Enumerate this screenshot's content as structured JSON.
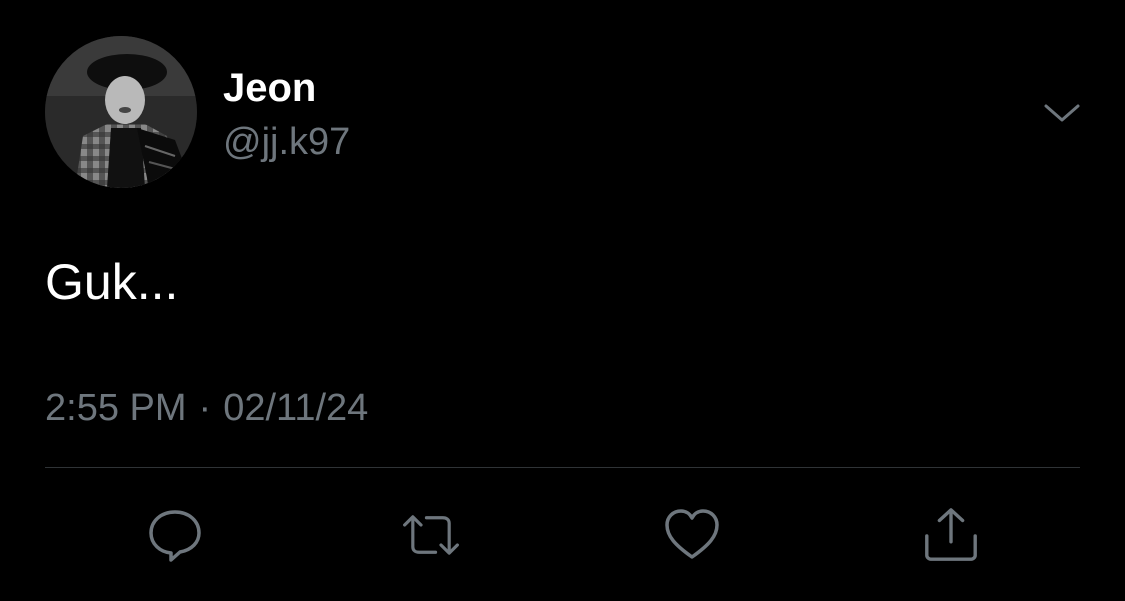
{
  "tweet": {
    "author": {
      "display_name": "Jeon",
      "handle": "@jj.k97",
      "avatar_icon": "profile-photo"
    },
    "text": "Guk...",
    "time": "2:55 PM",
    "separator": "·",
    "date": "02/11/24"
  },
  "actions": [
    {
      "name": "reply",
      "icon": "reply-icon"
    },
    {
      "name": "retweet",
      "icon": "retweet-icon"
    },
    {
      "name": "like",
      "icon": "heart-icon"
    },
    {
      "name": "share",
      "icon": "share-icon"
    }
  ],
  "colors": {
    "background": "#000000",
    "primary_text": "#ffffff",
    "secondary_text": "#6e767d",
    "divider": "#2f3336"
  }
}
